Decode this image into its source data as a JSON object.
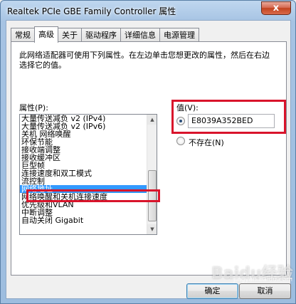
{
  "window": {
    "title": "Realtek PCIe GBE Family Controller 属性",
    "close_label": "x"
  },
  "tabs": [
    {
      "label": "常规",
      "active": false
    },
    {
      "label": "高级",
      "active": true
    },
    {
      "label": "关于",
      "active": false
    },
    {
      "label": "驱动程序",
      "active": false
    },
    {
      "label": "详细信息",
      "active": false
    },
    {
      "label": "电源管理",
      "active": false
    }
  ],
  "advanced": {
    "description": "此网络适配器可使用下列属性。在左边单击您想更改的属性，然后在右边选择它的值。",
    "property_label": "属性(P):",
    "properties": [
      "大量传送减负 v2 (IPv4)",
      "大量传送减负 v2 (IPv6)",
      "关机 网络唤醒",
      "环保节能",
      "接收端调整",
      "接收缓冲区",
      "巨型帧",
      "连接速度和双工模式",
      "流控制",
      "网络地址",
      "网络唤醒和关机连接速度",
      "优先级和VLAN",
      "中断调整",
      "自动关闭 Gigabit"
    ],
    "selected_index": 9,
    "value_label": "值(V):",
    "value": "E8039A352BED",
    "not_present_label": "不存在(N)"
  },
  "buttons": {
    "ok": "确定",
    "cancel": "取消"
  },
  "watermark": {
    "main": "Baidu经验",
    "sub": "jingyan.baidu.com"
  },
  "colors": {
    "highlight": "#d9142b",
    "selection": "#3399ff"
  }
}
